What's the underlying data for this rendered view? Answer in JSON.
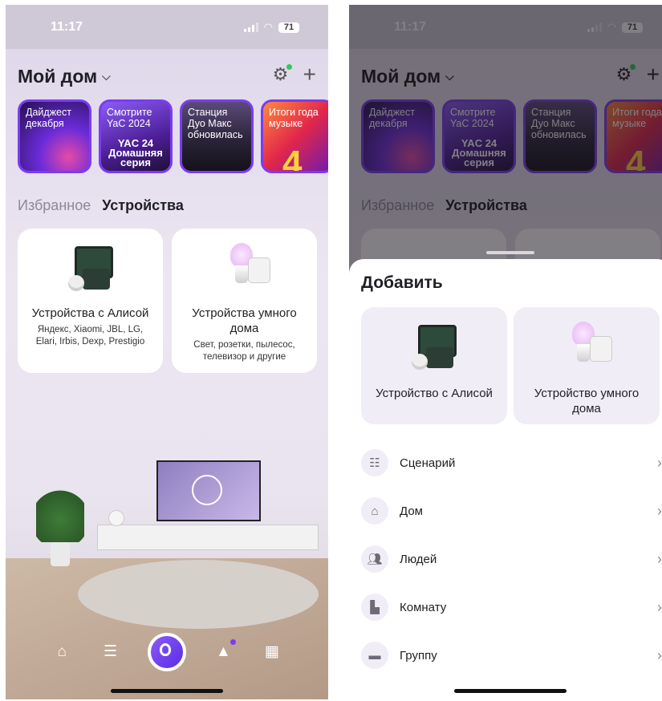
{
  "status": {
    "time": "11:17",
    "battery": "71"
  },
  "header": {
    "title": "Мой дом"
  },
  "stories": [
    {
      "text": "Дайджест декабря"
    },
    {
      "text": "Смотрите YaC 2024",
      "art": "YAC 24 Домашняя серия"
    },
    {
      "text": "Станция Дуо Макс обновилась"
    },
    {
      "text": "Итоги года музыке"
    }
  ],
  "tabs": {
    "favorites": "Избранное",
    "devices": "Устройства"
  },
  "cards": [
    {
      "name": "Устройства с Алисой",
      "sub": "Яндекс, Xiaomi, JBL, LG, Elari, Irbis, Dexp, Prestigio"
    },
    {
      "name": "Устройства умного дома",
      "sub": "Свет, розетки, пылесос, телевизор и другие"
    }
  ],
  "sheet": {
    "title": "Добавить",
    "cards": [
      {
        "name": "Устройство с Алисой"
      },
      {
        "name": "Устройство умного дома"
      }
    ],
    "items": [
      {
        "label": "Сценарий",
        "icon": "scenario-icon"
      },
      {
        "label": "Дом",
        "icon": "home-icon"
      },
      {
        "label": "Людей",
        "icon": "people-icon"
      },
      {
        "label": "Комнату",
        "icon": "room-icon"
      },
      {
        "label": "Группу",
        "icon": "folder-icon"
      }
    ]
  },
  "colors": {
    "accent": "#7b3cf2",
    "sheet_card_bg": "#f0edf6",
    "online_dot": "#35c759"
  }
}
